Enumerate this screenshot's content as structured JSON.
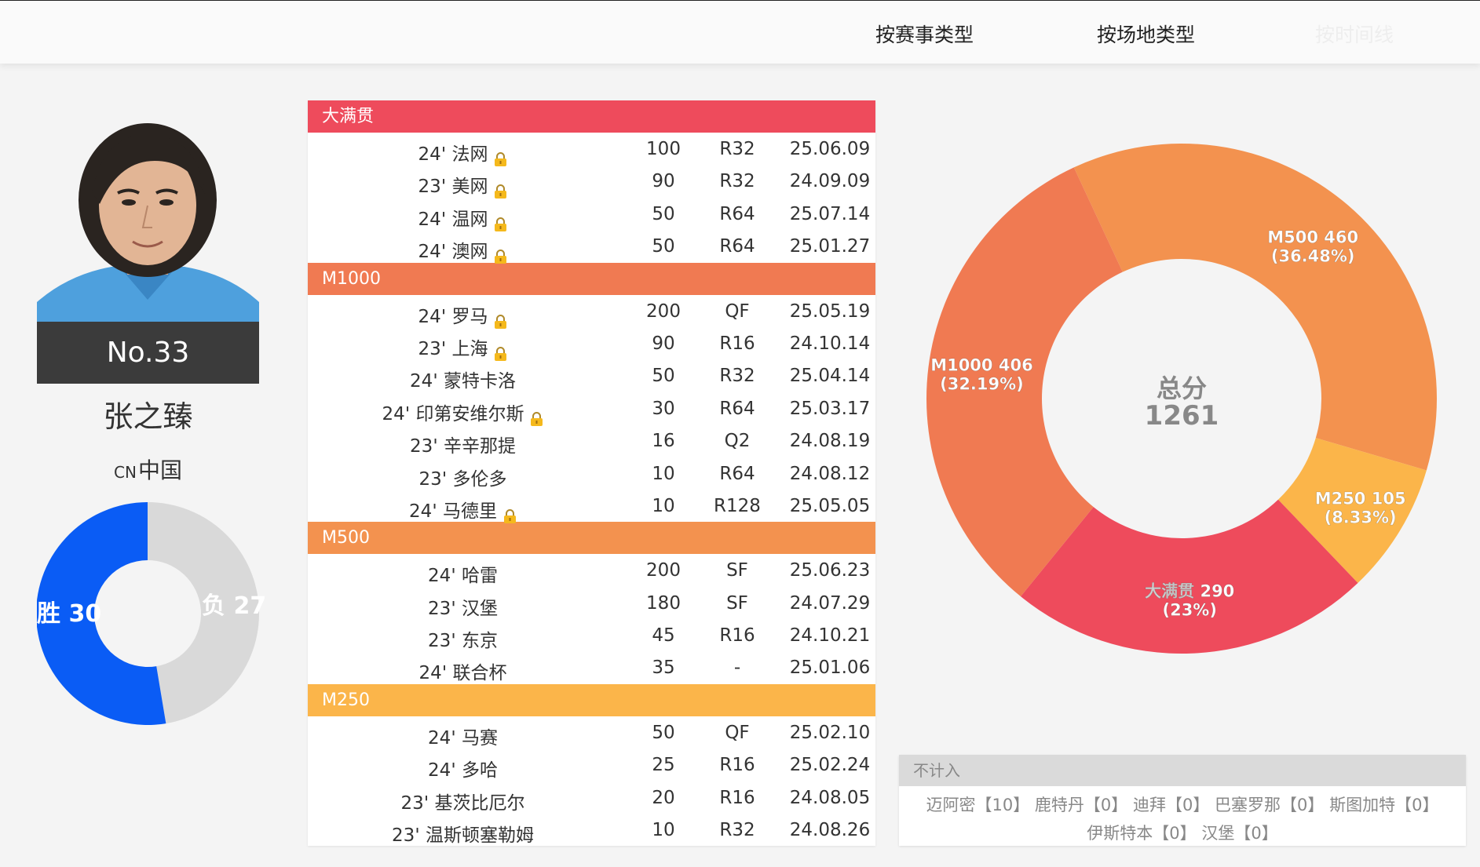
{
  "nav": {
    "tabs": [
      "按赛事类型",
      "按场地类型",
      "按时间线"
    ]
  },
  "player": {
    "number": "No.33",
    "name": "张之臻",
    "country_code": "CN",
    "country": "中国"
  },
  "win_loss": {
    "wins_label": "胜 30",
    "losses_label": "负 27",
    "wins": 30,
    "losses": 27,
    "colors": {
      "wins": "#0a5cf5",
      "losses": "#d9d9d9"
    }
  },
  "categories": [
    {
      "name": "大满贯",
      "color": "#ee4b5c",
      "rows": [
        {
          "event": "24' 法网",
          "locked": true,
          "points": "100",
          "round": "R32",
          "date": "25.06.09"
        },
        {
          "event": "23' 美网",
          "locked": true,
          "points": "90",
          "round": "R32",
          "date": "24.09.09"
        },
        {
          "event": "24' 温网",
          "locked": true,
          "points": "50",
          "round": "R64",
          "date": "25.07.14"
        },
        {
          "event": "24' 澳网",
          "locked": true,
          "points": "50",
          "round": "R64",
          "date": "25.01.27"
        }
      ]
    },
    {
      "name": "M1000",
      "color": "#f07a52",
      "rows": [
        {
          "event": "24' 罗马",
          "locked": true,
          "points": "200",
          "round": "QF",
          "date": "25.05.19"
        },
        {
          "event": "23' 上海",
          "locked": true,
          "points": "90",
          "round": "R16",
          "date": "24.10.14"
        },
        {
          "event": "24' 蒙特卡洛",
          "locked": false,
          "points": "50",
          "round": "R32",
          "date": "25.04.14"
        },
        {
          "event": "24' 印第安维尔斯",
          "locked": true,
          "points": "30",
          "round": "R64",
          "date": "25.03.17"
        },
        {
          "event": "23' 辛辛那提",
          "locked": false,
          "points": "16",
          "round": "Q2",
          "date": "24.08.19"
        },
        {
          "event": "23' 多伦多",
          "locked": false,
          "points": "10",
          "round": "R64",
          "date": "24.08.12"
        },
        {
          "event": "24' 马德里",
          "locked": true,
          "points": "10",
          "round": "R128",
          "date": "25.05.05"
        }
      ]
    },
    {
      "name": "M500",
      "color": "#f3924f",
      "rows": [
        {
          "event": "24' 哈雷",
          "locked": false,
          "points": "200",
          "round": "SF",
          "date": "25.06.23"
        },
        {
          "event": "23' 汉堡",
          "locked": false,
          "points": "180",
          "round": "SF",
          "date": "24.07.29"
        },
        {
          "event": "23' 东京",
          "locked": false,
          "points": "45",
          "round": "R16",
          "date": "24.10.21"
        },
        {
          "event": "24' 联合杯",
          "locked": false,
          "points": "35",
          "round": "-",
          "date": "25.01.06"
        }
      ]
    },
    {
      "name": "M250",
      "color": "#fbb54a",
      "rows": [
        {
          "event": "24' 马赛",
          "locked": false,
          "points": "50",
          "round": "QF",
          "date": "25.02.10"
        },
        {
          "event": "24' 多哈",
          "locked": false,
          "points": "25",
          "round": "R16",
          "date": "25.02.24"
        },
        {
          "event": "23' 基茨比厄尔",
          "locked": false,
          "points": "20",
          "round": "R16",
          "date": "24.08.05"
        },
        {
          "event": "23' 温斯顿塞勒姆",
          "locked": false,
          "points": "10",
          "round": "R32",
          "date": "24.08.26"
        }
      ]
    }
  ],
  "chart_data": {
    "type": "pie",
    "center_title": "总分",
    "center_value": "1261",
    "total": 1261,
    "slices": [
      {
        "name": "M500",
        "value": 460,
        "label": "M500 460",
        "pct": "(36.48%)",
        "color": "#f3924f"
      },
      {
        "name": "M250",
        "value": 105,
        "label": "M250 105",
        "pct": "(8.33%)",
        "color": "#fbb54a"
      },
      {
        "name": "大满贯",
        "value": 290,
        "label": "大满贯 290",
        "pct": "(23%)",
        "color": "#ee4b5c"
      },
      {
        "name": "M1000",
        "value": 406,
        "label": "M1000 406",
        "pct": "(32.19%)",
        "color": "#f07a52"
      }
    ]
  },
  "uncounted": {
    "title": "不计入",
    "items": [
      "迈阿密【10】",
      "鹿特丹【0】",
      "迪拜【0】",
      "巴塞罗那【0】",
      "斯图加特【0】",
      "伊斯特本【0】",
      "汉堡【0】"
    ]
  }
}
